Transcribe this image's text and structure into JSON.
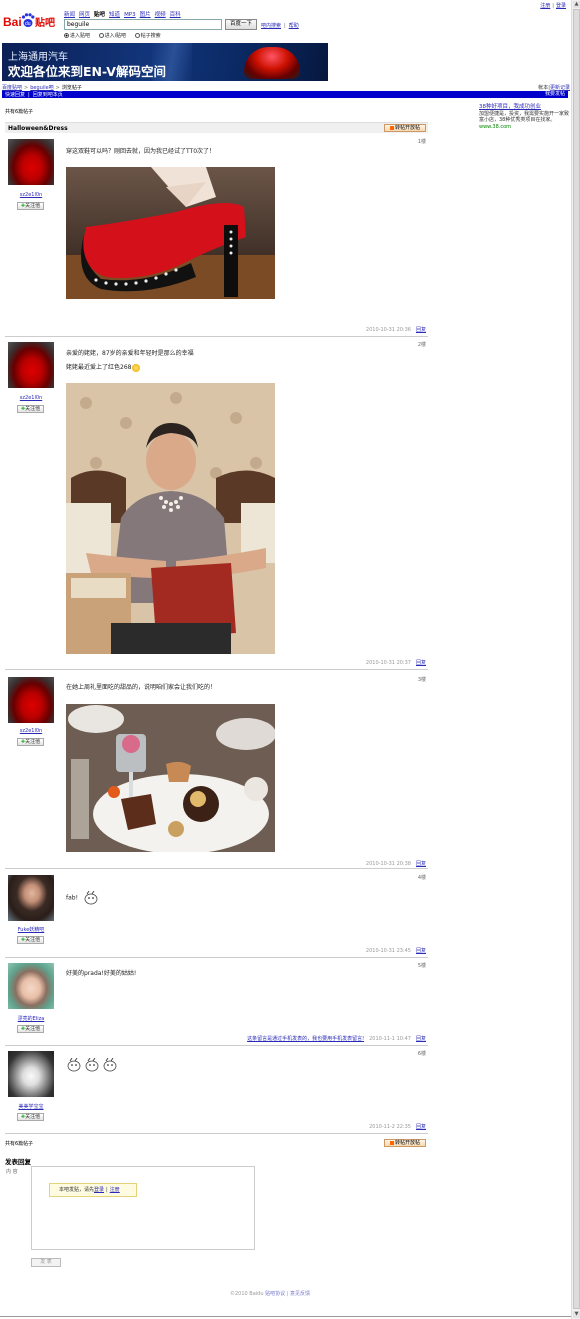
{
  "top_links": [
    "注册",
    "|",
    "登录"
  ],
  "logo": {
    "text_left": "Bai",
    "text_mid": "du",
    "text_right": "贴吧"
  },
  "nav": [
    "新闻",
    "网页",
    "贴吧",
    "知道",
    "MP3",
    "图片",
    "视频",
    "百科"
  ],
  "search": {
    "value": "beguile",
    "button": "百度一下",
    "links": [
      "吧内搜索",
      "|",
      "帮助"
    ]
  },
  "radios": [
    {
      "label": "进入贴吧",
      "selected": true
    },
    {
      "label": "进入i贴吧",
      "selected": false
    },
    {
      "label": "帖子搜索",
      "selected": false
    }
  ],
  "banner": {
    "line1": "上海通用汽车",
    "line2": "欢迎各位来到EN-V解码空间"
  },
  "breadcrumb": {
    "home": "百度贴吧",
    "sep": ">",
    "bar": "beguile吧",
    "current": "浏览帖子"
  },
  "right_top": [
    "帐本",
    "|",
    "更新记录"
  ],
  "bluebar": {
    "left": [
      "快速回复",
      "|",
      "回复到吧本页"
    ],
    "right": "我要发帖"
  },
  "post_count": "共有6篇帖子",
  "thread": {
    "title": "Halloween&Dress",
    "rss_button": "转帖开放帖"
  },
  "sidebar_ad": {
    "title": "38种好项目，我成功创业",
    "body": "加盟便捷是，投资，我需要实施开一家致富小店，38种优秀类项目在找家。",
    "url": "www.38.com"
  },
  "posts": [
    {
      "floor": "1楼",
      "user": "sz2e1l0n",
      "follow": "关注他",
      "lines": [
        "穿这双鞋可以吗？刚回去就，因为我已经试了TT0次了！"
      ],
      "time": "2010-10-31 20:36",
      "reply": "回复"
    },
    {
      "floor": "2楼",
      "user": "sz2e1l0n",
      "follow": "关注他",
      "lines": [
        "亲爱的姥姥，87岁的亲爱和年轻时是那么的幸福",
        "姥姥最近爱上了红色268"
      ],
      "time": "2010-10-31 20:37",
      "reply": "回复"
    },
    {
      "floor": "3楼",
      "user": "sz2e1l0n",
      "follow": "关注他",
      "lines": [
        "在她上周礼里面吃的甜品的，说明咱们家会让我们吃的！"
      ],
      "time": "2010-10-31 20:38",
      "reply": "回复"
    },
    {
      "floor": "4楼",
      "user": "Fuke妖精吧",
      "follow": "关注他",
      "lines": [
        "fab!"
      ],
      "time": "2010-10-31 23:45",
      "reply": "回复"
    },
    {
      "floor": "5楼",
      "user": "漂亮的Eliza",
      "follow": "关注他",
      "lines": [
        "好美的prada!好美的姑姑!"
      ],
      "client": "这条留言是通过手机发表的，我也要用手机发表留言!",
      "time": "2010-11-1 10:47",
      "reply": "回复"
    },
    {
      "floor": "6楼",
      "user": "美美学宝宝",
      "follow": "关注他",
      "lines": [
        ""
      ],
      "time": "2010-11-2 22:35",
      "reply": "回复"
    }
  ],
  "bottom": {
    "count": "共有6篇帖子",
    "rss_button": "转帖开放帖",
    "reply_title": "发表回复",
    "content_label": "内 容",
    "login_tip_pre": "本吧发贴，请先",
    "login_link": "登录",
    "sep": "|",
    "register_link": "注册",
    "submit": "发 表"
  },
  "footer": {
    "text": "©2010 Baidu ",
    "links": [
      "贴吧协议",
      "意见反馈"
    ]
  }
}
